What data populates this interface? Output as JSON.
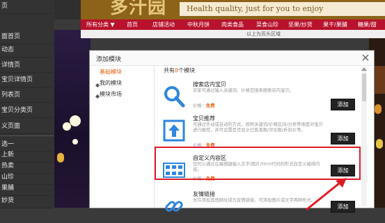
{
  "sidebar": {
    "items": [
      "页",
      "面首页",
      "动态",
      "详情页",
      "宝贝详情页",
      "列表页",
      "宝贝分类页",
      "义页面",
      "选一",
      "上新",
      "热卖",
      "山珍",
      "果脯",
      "妙货"
    ]
  },
  "banner": {
    "logo": "多汁园",
    "slogan": "Health quality, just for you to enjoy"
  },
  "nav": {
    "items": [
      "所有分类 ▼",
      "首页",
      "店铺活动",
      "中秋月饼",
      "肉类食品",
      "菜食山珍",
      "坚果/炒货",
      "果干/果脯",
      "糖果/甜"
    ]
  },
  "page_header": "以上为页头区域",
  "modal": {
    "title": "添加模块",
    "close_icon": "close-icon",
    "categories": [
      {
        "label": "基础模块",
        "active": true
      },
      {
        "label": "我的模块",
        "active": false
      },
      {
        "label": "模块市场",
        "active": false
      }
    ],
    "list_header_prefix": "共有",
    "list_header_count": "8",
    "list_header_suffix": "个模块",
    "modules": [
      {
        "name": "搜索店内宝贝",
        "description": "买家可通过输入关键词、价格范围来搜索店内宝贝。",
        "price_label": "价格：",
        "price_value": "免费",
        "button": "添加",
        "icon": "search-icon"
      },
      {
        "name": "宝贝推荐",
        "description": "可通过手动或自动的方式，按照关键词/价格区间/分类等维度对宝贝进行推荐，并可设置是否显示已售笔数/评论数/折扣价等。",
        "price_label": "价格：",
        "price_value": "免费",
        "button": "添加",
        "icon": "upload-arrow-icon"
      },
      {
        "name": "自定义内容区",
        "description": "您可以通过在编辑器输入文字/图片/html代码的形式自定义编排内容。",
        "price_label": "价格：",
        "price_value": "免费",
        "button": "添加",
        "icon": "grid-layout-icon"
      },
      {
        "name": "友情链接",
        "description": "允许添加其他网址成为友情链接，可添加图片或文字两种形式。",
        "price_label": "",
        "price_value": "",
        "button": "添加",
        "icon": "link-icon"
      }
    ]
  },
  "colors": {
    "accent": "#e8641a",
    "highlight": "#e01a24",
    "icon_blue": "#2e86de",
    "nav_red": "#b8122c",
    "banner_brown": "#8d6319"
  }
}
